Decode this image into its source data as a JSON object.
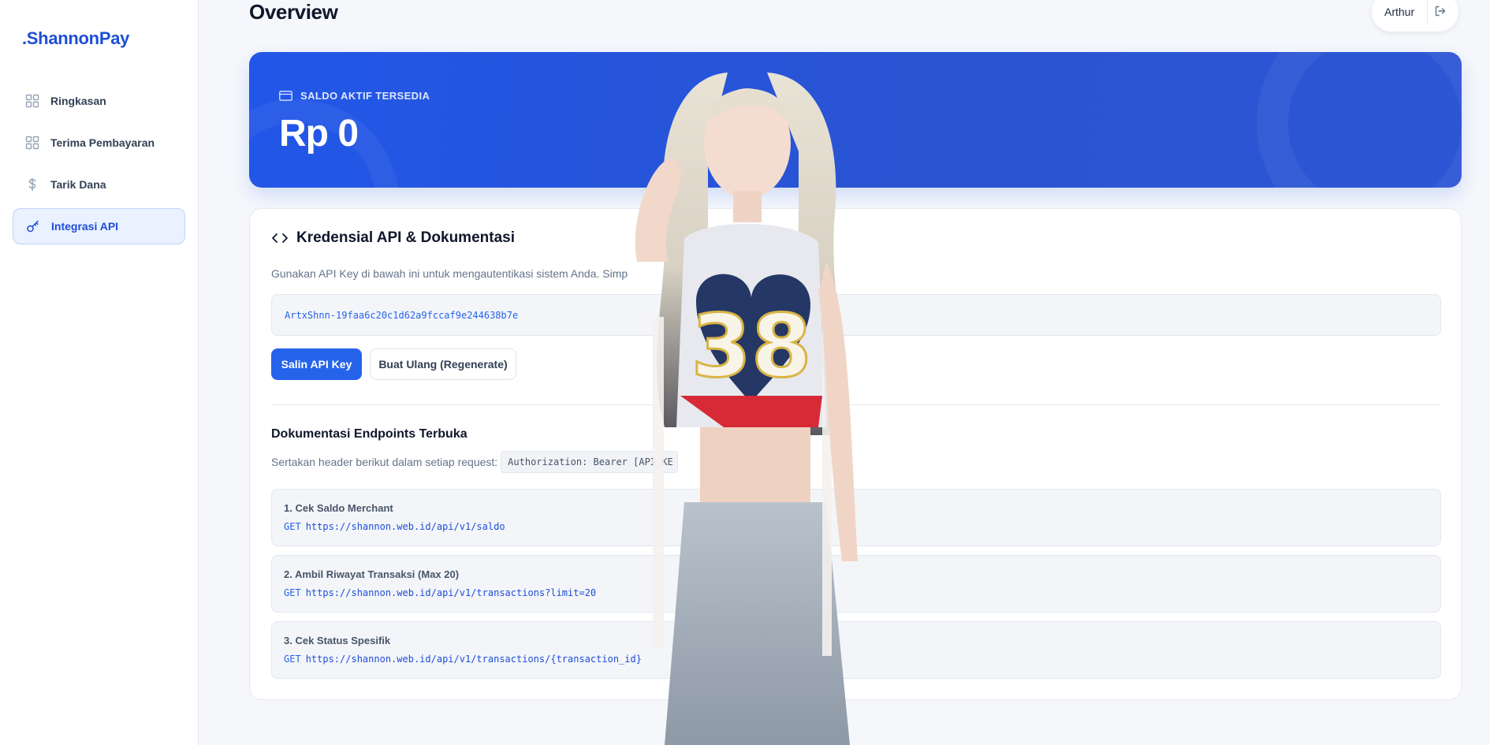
{
  "brand": ".ShannonPay",
  "sidebar": {
    "items": [
      {
        "label": "Ringkasan",
        "icon": "grid-icon"
      },
      {
        "label": "Terima Pembayaran",
        "icon": "grid-icon"
      },
      {
        "label": "Tarik Dana",
        "icon": "dollar-icon"
      },
      {
        "label": "Integrasi API",
        "icon": "key-icon",
        "active": true
      }
    ]
  },
  "header": {
    "title": "Overview",
    "user": "Arthur"
  },
  "balance": {
    "label": "SALDO AKTIF TERSEDIA",
    "value": "Rp 0"
  },
  "api": {
    "title": "Kredensial API & Dokumentasi",
    "description": "Gunakan API Key di bawah ini untuk mengautentikasi sistem Anda. Simp",
    "key": "ArtxShnn-19faa6c20c1d62a9fccaf9e244638b7e",
    "copy_label": "Salin API Key",
    "regenerate_label": "Buat Ulang (Regenerate)"
  },
  "docs": {
    "title": "Dokumentasi Endpoints Terbuka",
    "note": "Sertakan header berikut dalam setiap request:",
    "header_code": "Authorization: Bearer [API_KE",
    "endpoints": [
      {
        "title": "1. Cek Saldo Merchant",
        "method": "GET",
        "url": "https://shannon.web.id/api/v1/saldo"
      },
      {
        "title": "2. Ambil Riwayat Transaksi (Max 20)",
        "method": "GET",
        "url": "https://shannon.web.id/api/v1/transactions?limit=20"
      },
      {
        "title": "3. Cek Status Spesifik",
        "method": "GET",
        "url": "https://shannon.web.id/api/v1/transactions/{transaction_id}"
      }
    ]
  },
  "overlay": {
    "jersey_number": "38"
  },
  "colors": {
    "accent": "#2563eb",
    "card_blue": "#2156e8",
    "background": "#f5f7fb"
  }
}
